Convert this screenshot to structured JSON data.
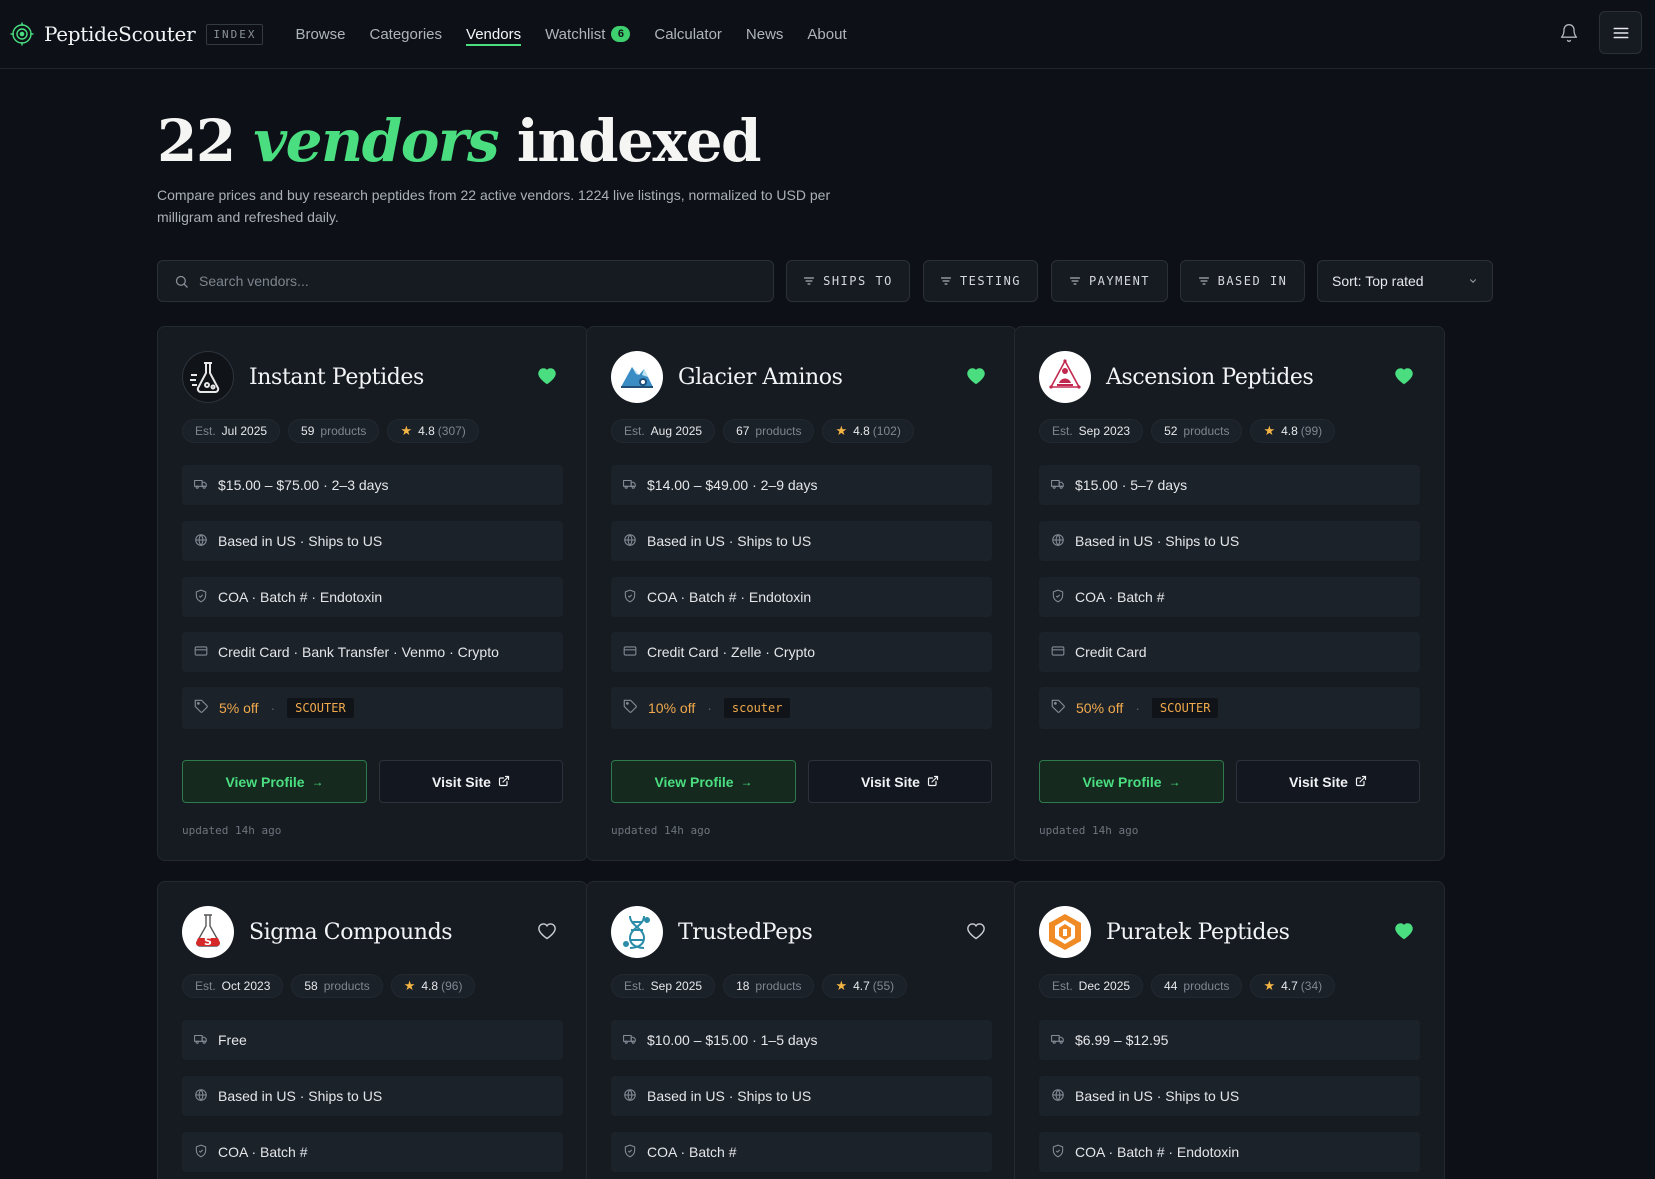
{
  "header": {
    "brand": "PeptideScouter",
    "brand_tag": "INDEX",
    "nav": [
      {
        "label": "Browse"
      },
      {
        "label": "Categories"
      },
      {
        "label": "Vendors",
        "active": true
      },
      {
        "label": "Watchlist",
        "badge": "6"
      },
      {
        "label": "Calculator"
      },
      {
        "label": "News"
      },
      {
        "label": "About"
      }
    ],
    "icons": [
      "target-logo-icon",
      "bell-icon",
      "menu-icon"
    ]
  },
  "hero": {
    "count": "22",
    "highlight": "vendors",
    "suffix": "indexed",
    "description": "Compare prices and buy research peptides from 22 active vendors. 1224 live listings, normalized to USD per milligram and refreshed daily."
  },
  "filters": {
    "search_placeholder": "Search vendors...",
    "buttons": [
      "SHIPS TO",
      "TESTING",
      "PAYMENT",
      "BASED IN"
    ],
    "sort_label": "Sort: Top rated"
  },
  "labels": {
    "est": "Est.",
    "products": "products",
    "view_profile": "View Profile",
    "visit_site": "Visit Site"
  },
  "colors": {
    "accent": "#4ade80",
    "discount": "#f0a94c",
    "star": "#f5b544",
    "background": "#0d1117",
    "card": "#161b22"
  },
  "vendors": [
    {
      "name": "Instant Peptides",
      "logo": "flask-logo",
      "favorited": true,
      "est": "Jul 2025",
      "products": "59",
      "rating": "4.8",
      "reviews": "(307)",
      "shipping": "$15.00 – $75.00 · 2–3 days",
      "location": "Based in US · Ships to US",
      "testing": "COA · Batch # · Endotoxin",
      "payment": "Credit Card · Bank Transfer · Venmo · Crypto",
      "discount": "5% off",
      "code": "SCOUTER",
      "updated": "updated 14h ago"
    },
    {
      "name": "Glacier Aminos",
      "logo": "glacier-logo",
      "favorited": true,
      "est": "Aug 2025",
      "products": "67",
      "rating": "4.8",
      "reviews": "(102)",
      "shipping": "$14.00 – $49.00 · 2–9 days",
      "location": "Based in US · Ships to US",
      "testing": "COA · Batch # · Endotoxin",
      "payment": "Credit Card · Zelle · Crypto",
      "discount": "10% off",
      "code": "scouter",
      "updated": "updated 14h ago"
    },
    {
      "name": "Ascension Peptides",
      "logo": "meditation-logo",
      "favorited": true,
      "est": "Sep 2023",
      "products": "52",
      "rating": "4.8",
      "reviews": "(99)",
      "shipping": "$15.00 · 5–7 days",
      "location": "Based in US · Ships to US",
      "testing": "COA · Batch #",
      "payment": "Credit Card",
      "discount": "50% off",
      "code": "SCOUTER",
      "updated": "updated 14h ago"
    },
    {
      "name": "Sigma Compounds",
      "logo": "sigma-flask-logo",
      "favorited": false,
      "est": "Oct 2023",
      "products": "58",
      "rating": "4.8",
      "reviews": "(96)",
      "shipping": "Free",
      "location": "Based in US · Ships to US",
      "testing": "COA · Batch #"
    },
    {
      "name": "TrustedPeps",
      "logo": "dna-logo",
      "favorited": false,
      "est": "Sep 2025",
      "products": "18",
      "rating": "4.7",
      "reviews": "(55)",
      "shipping": "$10.00 – $15.00 · 1–5 days",
      "location": "Based in US · Ships to US",
      "testing": "COA · Batch #"
    },
    {
      "name": "Puratek Peptides",
      "logo": "hexagon-logo",
      "favorited": true,
      "est": "Dec 2025",
      "products": "44",
      "rating": "4.7",
      "reviews": "(34)",
      "shipping": "$6.99 – $12.95",
      "location": "Based in US · Ships to US",
      "testing": "COA · Batch # · Endotoxin"
    }
  ]
}
